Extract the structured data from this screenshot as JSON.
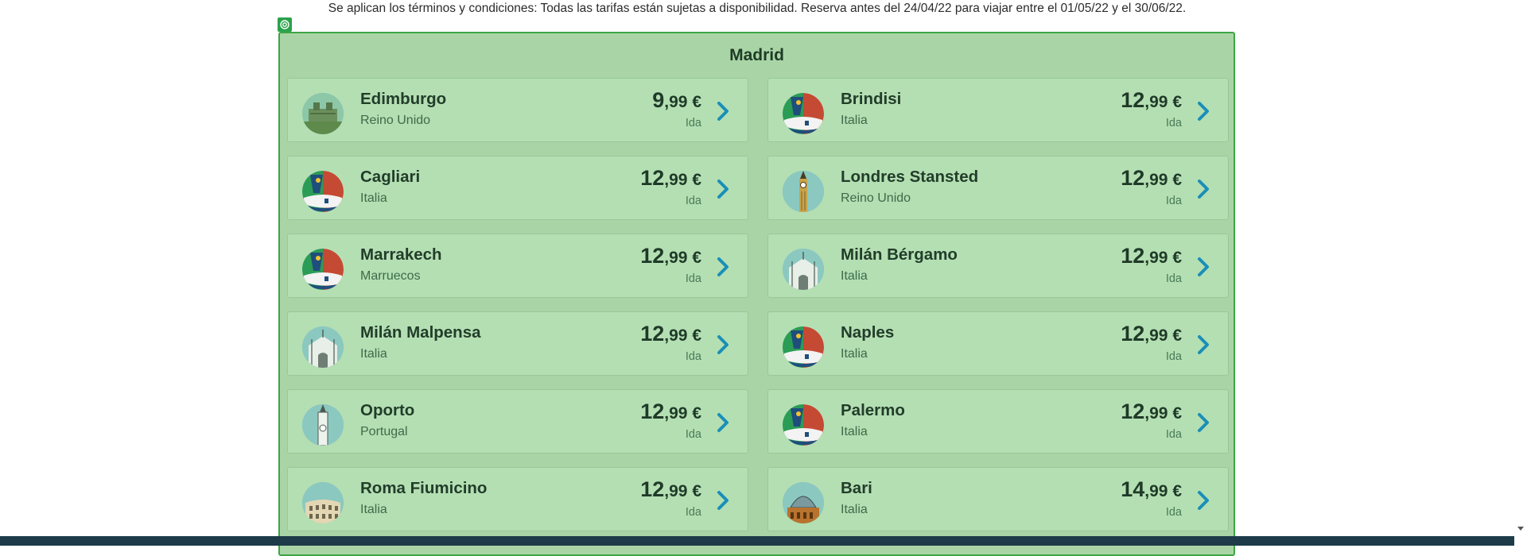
{
  "terms_text": "Se aplican los términos y condiciones: Todas las tarifas están sujetas a disponibilidad. Reserva antes del 24/04/22 para viajar entre el 01/05/22 y el 30/06/22.",
  "origin_title": "Madrid",
  "colors": {
    "panel_bg": "#a9d5a6",
    "panel_border": "#3da545",
    "card_bg": "#b4dfb3",
    "chevron": "#1a8fb8",
    "text_dark": "#1f3a28"
  },
  "destinations": [
    {
      "city": "Edimburgo",
      "country": "Reino Unido",
      "price_int": "9",
      "price_dec": ",99",
      "currency": " €",
      "direction": "Ida",
      "icon": "castle-icon"
    },
    {
      "city": "Brindisi",
      "country": "Italia",
      "price_int": "12",
      "price_dec": ",99",
      "currency": " €",
      "direction": "Ida",
      "icon": "airplane-tail-icon"
    },
    {
      "city": "Cagliari",
      "country": "Italia",
      "price_int": "12",
      "price_dec": ",99",
      "currency": " €",
      "direction": "Ida",
      "icon": "airplane-tail-icon"
    },
    {
      "city": "Londres Stansted",
      "country": "Reino Unido",
      "price_int": "12",
      "price_dec": ",99",
      "currency": " €",
      "direction": "Ida",
      "icon": "big-ben-icon"
    },
    {
      "city": "Marrakech",
      "country": "Marruecos",
      "price_int": "12",
      "price_dec": ",99",
      "currency": " €",
      "direction": "Ida",
      "icon": "airplane-tail-icon"
    },
    {
      "city": "Milán Bérgamo",
      "country": "Italia",
      "price_int": "12",
      "price_dec": ",99",
      "currency": " €",
      "direction": "Ida",
      "icon": "cathedral-icon"
    },
    {
      "city": "Milán Malpensa",
      "country": "Italia",
      "price_int": "12",
      "price_dec": ",99",
      "currency": " €",
      "direction": "Ida",
      "icon": "cathedral-icon"
    },
    {
      "city": "Naples",
      "country": "Italia",
      "price_int": "12",
      "price_dec": ",99",
      "currency": " €",
      "direction": "Ida",
      "icon": "airplane-tail-icon"
    },
    {
      "city": "Oporto",
      "country": "Portugal",
      "price_int": "12",
      "price_dec": ",99",
      "currency": " €",
      "direction": "Ida",
      "icon": "clock-tower-icon"
    },
    {
      "city": "Palermo",
      "country": "Italia",
      "price_int": "12",
      "price_dec": ",99",
      "currency": " €",
      "direction": "Ida",
      "icon": "airplane-tail-icon"
    },
    {
      "city": "Roma Fiumicino",
      "country": "Italia",
      "price_int": "12",
      "price_dec": ",99",
      "currency": " €",
      "direction": "Ida",
      "icon": "colosseum-icon"
    },
    {
      "city": "Bari",
      "country": "Italia",
      "price_int": "14",
      "price_dec": ",99",
      "currency": " €",
      "direction": "Ida",
      "icon": "dome-icon"
    }
  ]
}
